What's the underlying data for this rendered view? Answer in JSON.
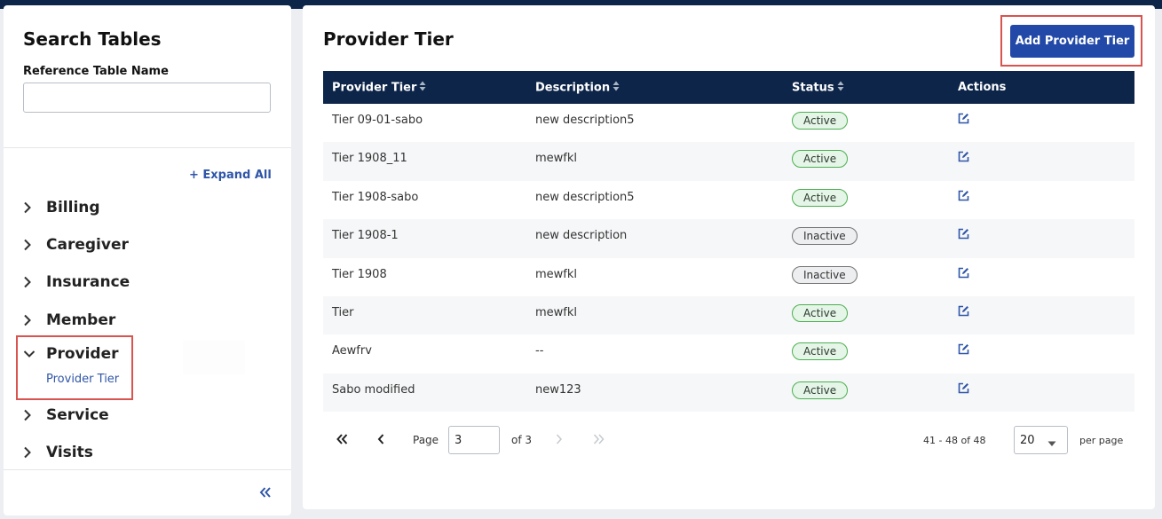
{
  "sidebar": {
    "title": "Search Tables",
    "field_label": "Reference Table Name",
    "field_value": "",
    "expand_all": "+ Expand All",
    "items": [
      {
        "label": "Billing",
        "expanded": false
      },
      {
        "label": "Caregiver",
        "expanded": false
      },
      {
        "label": "Insurance",
        "expanded": false
      },
      {
        "label": "Member",
        "expanded": false
      },
      {
        "label": "Provider",
        "expanded": true
      },
      {
        "label": "Service",
        "expanded": false
      },
      {
        "label": "Visits",
        "expanded": false
      }
    ],
    "sub_item": "Provider Tier",
    "collapse_icon": "double-chevron-left-icon"
  },
  "main": {
    "title": "Provider Tier",
    "add_button": "Add Provider Tier",
    "columns": [
      "Provider Tier",
      "Description",
      "Status",
      "Actions"
    ],
    "rows": [
      {
        "tier": "Tier 09-01-sabo",
        "description": "new description5",
        "status": "Active"
      },
      {
        "tier": "Tier 1908_11",
        "description": "mewfkl",
        "status": "Active"
      },
      {
        "tier": "Tier 1908-sabo",
        "description": "new description5",
        "status": "Active"
      },
      {
        "tier": "Tier 1908-1",
        "description": "new description",
        "status": "Inactive"
      },
      {
        "tier": "Tier 1908",
        "description": "mewfkl",
        "status": "Inactive"
      },
      {
        "tier": "Tier",
        "description": "mewfkl",
        "status": "Active"
      },
      {
        "tier": "Aewfrv",
        "description": "--",
        "status": "Active"
      },
      {
        "tier": "Sabo modified",
        "description": "new123",
        "status": "Active"
      }
    ],
    "action_icon": "edit-icon"
  },
  "pagination": {
    "page_label": "Page",
    "page_value": "3",
    "of_label": "of 3",
    "range": "41 - 48 of 48",
    "per_page_value": "20",
    "per_page_label": "per page"
  },
  "colors": {
    "navy": "#0d2549",
    "button": "#2349a8",
    "link": "#2f56a8",
    "highlight": "#d9534f",
    "active_bg": "#e5f5e8",
    "active_border": "#4caf50"
  }
}
